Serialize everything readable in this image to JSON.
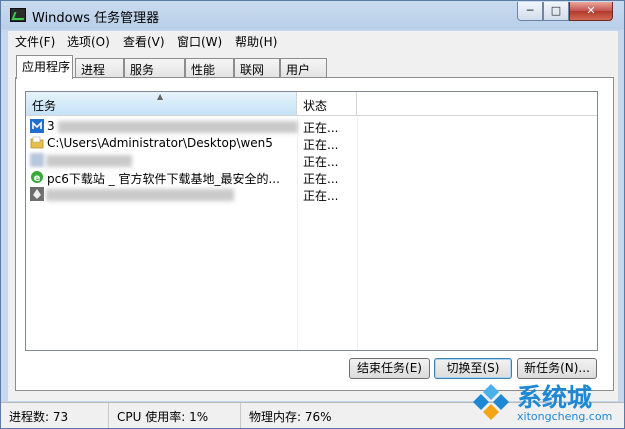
{
  "window": {
    "title": "Windows 任务管理器",
    "min_glyph": "─",
    "max_glyph": "□",
    "close_glyph": "✕"
  },
  "menu": [
    "文件(F)",
    "选项(O)",
    "查看(V)",
    "窗口(W)",
    "帮助(H)"
  ],
  "tabs": [
    "应用程序",
    "进程",
    "服务",
    "性能",
    "联网",
    "用户"
  ],
  "active_tab": "应用程序",
  "list": {
    "columns": [
      "任务",
      "状态"
    ],
    "rows": [
      {
        "icon": "app-blue-m-icon",
        "name": "3",
        "status": "正在..."
      },
      {
        "icon": "folder-icon",
        "name": "C:\\Users\\Administrator\\Desktop\\wen5",
        "status": "正在..."
      },
      {
        "icon": "blurred-app-icon",
        "name": "",
        "status": "正在..."
      },
      {
        "icon": "ie-browser-icon",
        "name": "pc6下载站 _ 官方软件下载基地_最安全的...",
        "status": "正在..."
      },
      {
        "icon": "pen-app-icon",
        "name": "",
        "status": "正在..."
      }
    ]
  },
  "buttons": {
    "end_task": "结束任务(E)",
    "switch_to": "切换至(S)",
    "new_task": "新任务(N)..."
  },
  "status": {
    "processes": "进程数: 73",
    "cpu": "CPU 使用率: 1%",
    "memory": "物理内存: 76%"
  },
  "watermark": {
    "text": "系统城",
    "url": "xitongcheng.com"
  },
  "colors": {
    "accent": "#1e88d4",
    "header_selected": "#c5e3f7",
    "close": "#c75050"
  }
}
